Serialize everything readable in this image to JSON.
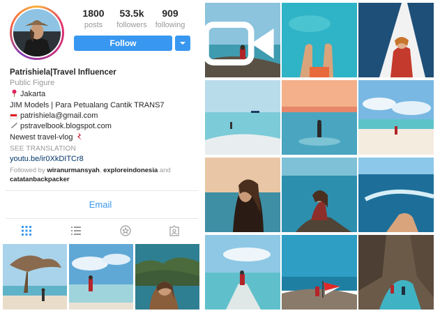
{
  "profile": {
    "stats": [
      {
        "value": "1800",
        "label": "posts"
      },
      {
        "value": "53.5k",
        "label": "followers"
      },
      {
        "value": "909",
        "label": "following"
      }
    ],
    "follow_label": "Follow",
    "name": "Patrishiela|Travel Influencer",
    "category": "Public Figure",
    "location": "Jakarta",
    "tagline": "JIM Models | Para Petualang Cantik TRANS7",
    "email_line": "patrishiela@gmail.com",
    "blog_line": "pstravelbook.blogspot.com",
    "vlog_line": "Newest travel-vlog",
    "see_translation": "SEE TRANSLATION",
    "youtube_link": "youtu.be/ir0XkDITCr8",
    "followed_by_prefix": "Followed by",
    "followed_by_user1": "wiranurmansyah",
    "followed_by_user2": "exploreindonesia",
    "followed_by_and": "and",
    "followed_by_user3": "catatanbackpacker",
    "email_button": "Email"
  },
  "tabs": [
    "grid-icon",
    "list-icon",
    "saved-star-icon",
    "tagged-icon"
  ],
  "colors": {
    "accent": "#3897f0",
    "secondary_text": "#999999",
    "link": "#003569",
    "primary_text": "#262626"
  },
  "posts": {
    "profile_thumbnails": [
      "beach-tree-photo",
      "beach-walk-photo",
      "island-cliff-photo"
    ],
    "grid": [
      "sea-rock-photo-video",
      "feet-in-water-photo",
      "boat-bow-photo",
      "shallow-sandbar-photo",
      "sunset-sea-photo",
      "beach-walk-photo",
      "portrait-sea-photo",
      "sitting-rock-photo",
      "boat-hand-photo",
      "sandbar-walk-photo",
      "flag-rock-photo",
      "cave-lagoon-photo"
    ]
  }
}
